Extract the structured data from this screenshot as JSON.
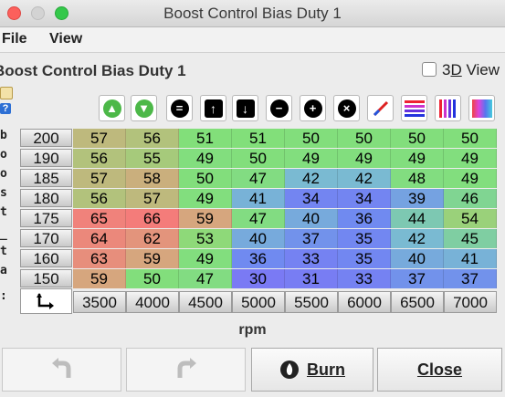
{
  "window": {
    "title": "Boost Control Bias Duty 1"
  },
  "menu": {
    "file": "File",
    "view": "View"
  },
  "heading": "Boost Control Bias Duty 1",
  "view3d": {
    "label_prefix": "3",
    "label_underlined": "D",
    "label_suffix": " View",
    "checked": false
  },
  "sidebar_letters": [
    "b",
    "o",
    "o",
    "s",
    "t",
    "_",
    "t",
    "a",
    ":"
  ],
  "toolbar": {
    "icons": [
      "arrow-up-circle-icon",
      "arrow-down-circle-icon",
      "minus-circle-icon",
      "arrow-up-box-icon",
      "arrow-down-box-icon",
      "minus-circle-icon",
      "plus-circle-icon",
      "times-circle-icon",
      "pencil-icon",
      "horizontal-gradient-icon",
      "vertical-gradient-icon",
      "color-gradient-icon"
    ]
  },
  "table": {
    "y_labels": [
      "200",
      "190",
      "185",
      "180",
      "175",
      "170",
      "160",
      "150"
    ],
    "x_labels": [
      "3500",
      "4000",
      "4500",
      "5000",
      "5500",
      "6000",
      "6500",
      "7000"
    ],
    "rows": [
      [
        "57",
        "56",
        "51",
        "51",
        "50",
        "50",
        "50",
        "50"
      ],
      [
        "56",
        "55",
        "49",
        "50",
        "49",
        "49",
        "49",
        "49"
      ],
      [
        "57",
        "58",
        "50",
        "47",
        "42",
        "42",
        "48",
        "49"
      ],
      [
        "56",
        "57",
        "49",
        "41",
        "34",
        "34",
        "39",
        "46"
      ],
      [
        "65",
        "66",
        "59",
        "47",
        "40",
        "36",
        "44",
        "54"
      ],
      [
        "64",
        "62",
        "53",
        "40",
        "37",
        "35",
        "42",
        "45"
      ],
      [
        "63",
        "59",
        "49",
        "36",
        "33",
        "35",
        "40",
        "41"
      ],
      [
        "59",
        "50",
        "47",
        "30",
        "31",
        "33",
        "37",
        "37"
      ]
    ]
  },
  "x_axis_label": "rpm",
  "buttons": {
    "burn": "Burn",
    "close": "Close"
  }
}
